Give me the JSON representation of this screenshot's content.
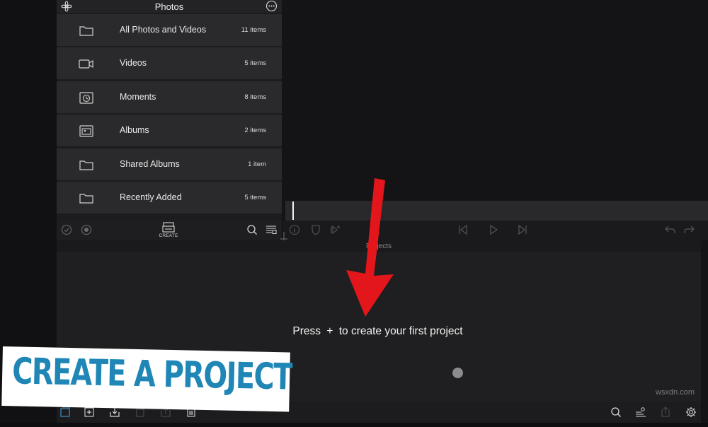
{
  "photos_panel": {
    "title": "Photos",
    "items": [
      {
        "label": "All Photos and Videos",
        "count": "11 items",
        "icon": "folder-icon"
      },
      {
        "label": "Videos",
        "count": "5 items",
        "icon": "video-camera-icon"
      },
      {
        "label": "Moments",
        "count": "8 items",
        "icon": "moments-clock-icon"
      },
      {
        "label": "Albums",
        "count": "2 items",
        "icon": "albums-icon"
      },
      {
        "label": "Shared Albums",
        "count": "1 item",
        "icon": "folder-icon"
      },
      {
        "label": "Recently Added",
        "count": "5 items",
        "icon": "folder-icon"
      }
    ],
    "toolbar": {
      "create_label": "CREATE"
    }
  },
  "projects": {
    "title": "Projects",
    "empty_message_before": "Press",
    "empty_message_plus": "+",
    "empty_message_after": "to create your first project"
  },
  "overlay": {
    "banner_text": "CREATE A PROJECT",
    "banner_color": "#1f86b5",
    "arrow_color": "#e3161b"
  },
  "watermark": "wsxdn.com"
}
